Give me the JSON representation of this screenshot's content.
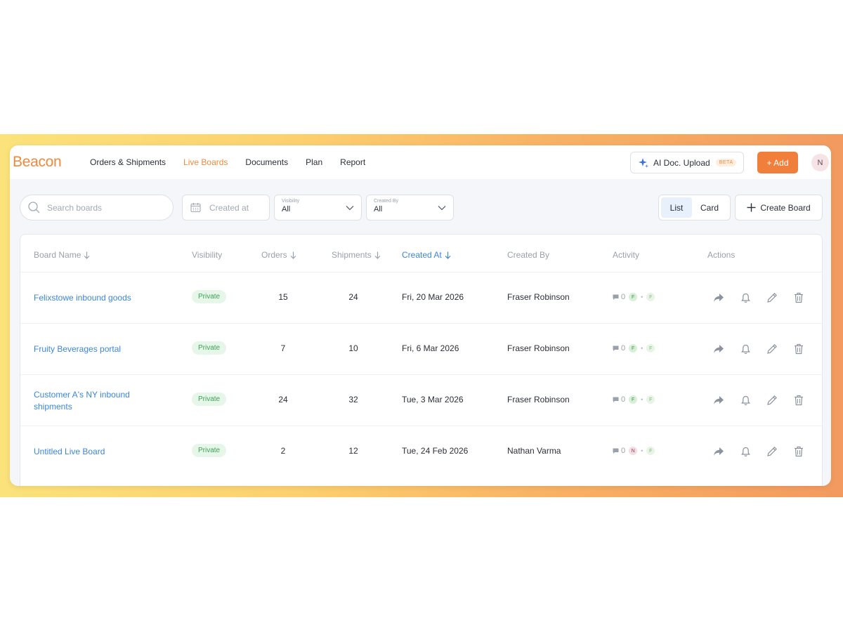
{
  "app": {
    "logo": "Beacon"
  },
  "nav": {
    "items": [
      {
        "label": "Orders & Shipments",
        "active": false
      },
      {
        "label": "Live Boards",
        "active": true
      },
      {
        "label": "Documents",
        "active": false
      },
      {
        "label": "Plan",
        "active": false
      },
      {
        "label": "Report",
        "active": false
      }
    ]
  },
  "header": {
    "ai_upload_label": "AI Doc. Upload",
    "ai_badge": "BETA",
    "add_label": "+ Add",
    "avatar_initial": "N",
    "colors": {
      "accent": "#ef7f3a",
      "link": "#3b86d9"
    }
  },
  "filters": {
    "search_placeholder": "Search boards",
    "created_at_placeholder": "Created at",
    "visibility": {
      "label": "Visibility",
      "value": "All"
    },
    "created_by": {
      "label": "Created By",
      "value": "All"
    },
    "view_toggle": {
      "list": "List",
      "card": "Card",
      "selected": "List"
    },
    "create_board_label": "Create Board"
  },
  "table": {
    "columns": {
      "board_name": "Board Name",
      "visibility": "Visibility",
      "orders": "Orders",
      "shipments": "Shipments",
      "created_at": "Created At",
      "created_by": "Created By",
      "activity": "Activity",
      "actions": "Actions"
    },
    "rows": [
      {
        "name": "Felixstowe inbound goods",
        "visibility": "Private",
        "orders": "15",
        "shipments": "24",
        "created_at": "Fri, 20 Mar 2026",
        "created_by": "Fraser Robinson",
        "comments": "0",
        "avatar1": "F",
        "avatar2": "F"
      },
      {
        "name": "Fruity Beverages portal",
        "visibility": "Private",
        "orders": "7",
        "shipments": "10",
        "created_at": "Fri, 6 Mar 2026",
        "created_by": "Fraser Robinson",
        "comments": "0",
        "avatar1": "F",
        "avatar2": "F"
      },
      {
        "name": "Customer A's NY inbound shipments",
        "visibility": "Private",
        "orders": "24",
        "shipments": "32",
        "created_at": "Tue, 3 Mar 2026",
        "created_by": "Fraser Robinson",
        "comments": "0",
        "avatar1": "F",
        "avatar2": "F"
      },
      {
        "name": "Untitled Live Board",
        "visibility": "Private",
        "orders": "2",
        "shipments": "12",
        "created_at": "Tue, 24 Feb 2026",
        "created_by": "Nathan Varma",
        "comments": "0",
        "avatar1": "N",
        "avatar2": "F"
      }
    ]
  }
}
